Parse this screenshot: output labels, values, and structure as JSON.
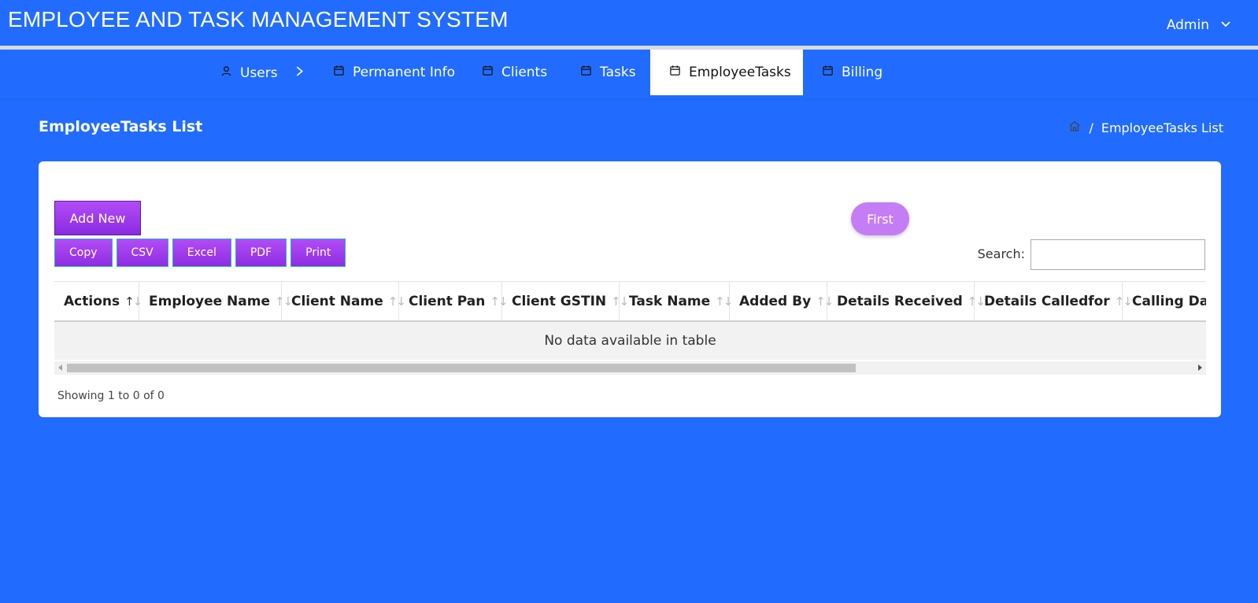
{
  "header": {
    "title": "EMPLOYEE AND TASK MANAGEMENT SYSTEM",
    "user_label": "Admin"
  },
  "nav": {
    "items": [
      {
        "label": "Users",
        "icon": "user-icon"
      },
      {
        "label": "Permanent Info",
        "icon": "calendar-icon"
      },
      {
        "label": "Clients",
        "icon": "calendar-icon"
      },
      {
        "label": "Tasks",
        "icon": "calendar-icon"
      },
      {
        "label": "EmployeeTasks",
        "icon": "calendar-icon",
        "active": true
      },
      {
        "label": "Billing",
        "icon": "calendar-icon"
      }
    ]
  },
  "page": {
    "title": "EmployeeTasks List",
    "breadcrumb_current": "EmployeeTasks List",
    "breadcrumb_separator": "/"
  },
  "toolbar": {
    "add_new": "Add New",
    "exports": [
      "Copy",
      "CSV",
      "Excel",
      "PDF",
      "Print"
    ],
    "first": "First",
    "search_label": "Search:",
    "search_value": ""
  },
  "table": {
    "columns": [
      "Actions",
      "Employee Name",
      "Client Name",
      "Client Pan",
      "Client GSTIN",
      "Task Name",
      "Added By",
      "Details Received",
      "Details Calledfor",
      "Calling Date"
    ],
    "empty_message": "No data available in table",
    "info": "Showing 1 to 0 of 0"
  },
  "colors": {
    "background": "#216cfe",
    "button_purple": "#9b3bf0",
    "first_button": "#c57df5"
  }
}
